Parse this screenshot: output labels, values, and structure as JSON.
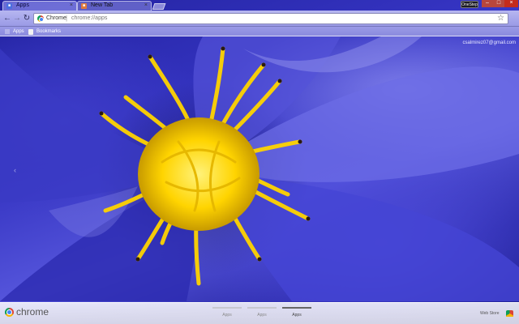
{
  "tabs": [
    {
      "label": "Apps",
      "active": true
    },
    {
      "label": "New Tab",
      "active": false
    }
  ],
  "window": {
    "profile_label": "OneStep"
  },
  "toolbar": {
    "back_icon": "arrow-left-icon",
    "forward_icon": "arrow-right-icon",
    "reload_icon": "reload-icon",
    "omnibox_chip": "Chrome",
    "omnibox_url": "chrome://apps"
  },
  "bookmarks": {
    "items": [
      {
        "label": "Apps",
        "icon": "apps-grid-icon"
      },
      {
        "label": "Bookmarks",
        "icon": "folder-icon"
      }
    ]
  },
  "ntp": {
    "user_email": "csalmirez07@gmail.com"
  },
  "bottom_bar": {
    "brand": "chrome",
    "pages": [
      {
        "label": "Apps",
        "active": false
      },
      {
        "label": "Apps",
        "active": false
      },
      {
        "label": "Apps",
        "active": true
      }
    ],
    "webstore_label": "Web Store"
  },
  "colors": {
    "petal": "#3534c2",
    "stamen": "#ffd400",
    "chrome_bar": "#9a9ae6"
  }
}
